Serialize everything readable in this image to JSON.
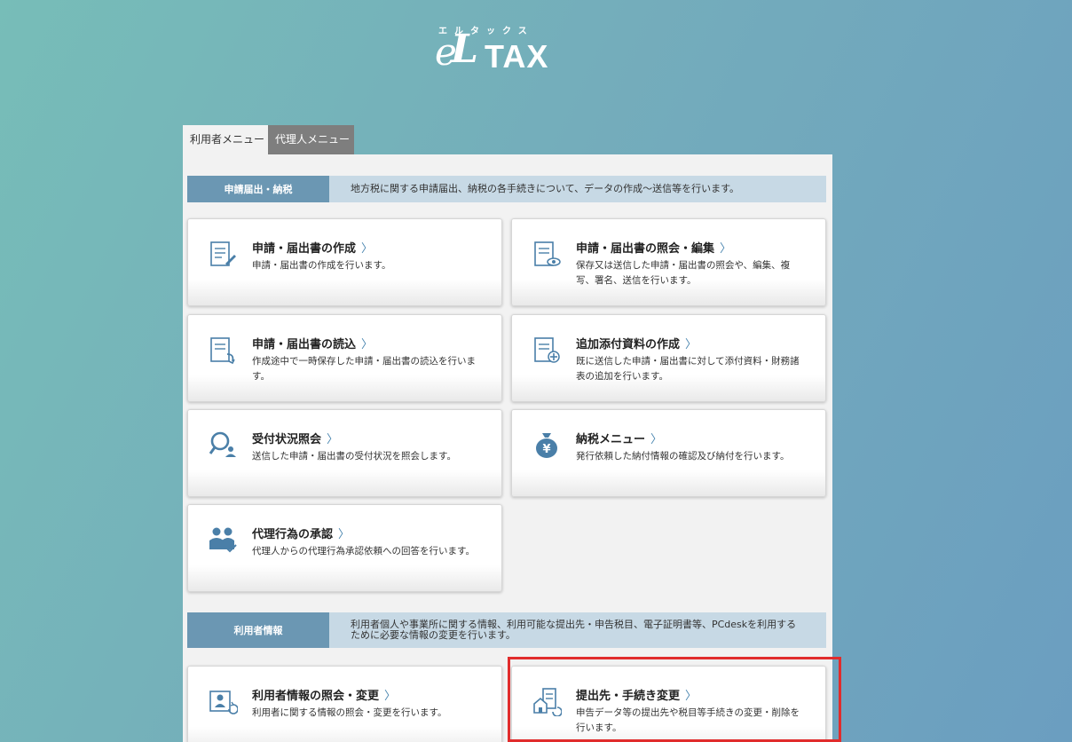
{
  "logo": {
    "kana": "エルタックス",
    "e": "e",
    "l": "L",
    "tax": "TAX"
  },
  "tabs": [
    {
      "label": "利用者メニュー"
    },
    {
      "label": "代理人メニュー"
    }
  ],
  "sections": [
    {
      "label": "申請届出・納税",
      "description": "地方税に関する申請届出、納税の各手続きについて、データの作成～送信等を行います。"
    },
    {
      "label": "利用者情報",
      "description": "利用者個人や事業所に関する情報、利用可能な提出先・申告税目、電子証明書等、PCdeskを利用するために必要な情報の変更を行います。"
    }
  ],
  "cards": [
    {
      "title": "申請・届出書の作成",
      "description": "申請・届出書の作成を行います。",
      "icon": "document-edit-icon"
    },
    {
      "title": "申請・届出書の照会・編集",
      "description": "保存又は送信した申請・届出書の照会や、編集、複写、署名、送信を行います。",
      "icon": "document-view-icon"
    },
    {
      "title": "申請・届出書の読込",
      "description": "作成途中で一時保存した申請・届出書の読込を行います。",
      "icon": "document-load-icon"
    },
    {
      "title": "追加添付資料の作成",
      "description": "既に送信した申請・届出書に対して添付資料・財務諸表の追加を行います。",
      "icon": "document-add-icon"
    },
    {
      "title": "受付状況照会",
      "description": "送信した申請・届出書の受付状況を照会します。",
      "icon": "search-person-icon"
    },
    {
      "title": "納税メニュー",
      "description": "発行依頼した納付情報の確認及び納付を行います。",
      "icon": "yen-bag-icon"
    },
    {
      "title": "代理行為の承認",
      "description": "代理人からの代理行為承認依頼への回答を行います。",
      "icon": "people-check-icon"
    },
    {
      "title": "利用者情報の照会・変更",
      "description": "利用者に関する情報の照会・変更を行います。",
      "icon": "user-info-icon"
    },
    {
      "title": "提出先・手続き変更",
      "description": "申告データ等の提出先や税目等手続きの変更・削除を行います。",
      "icon": "building-refresh-icon"
    }
  ],
  "chevron": "〉",
  "colors": {
    "accent": "#6b97b3",
    "highlight": "#e12c2c",
    "icon": "#4a7fa8"
  }
}
